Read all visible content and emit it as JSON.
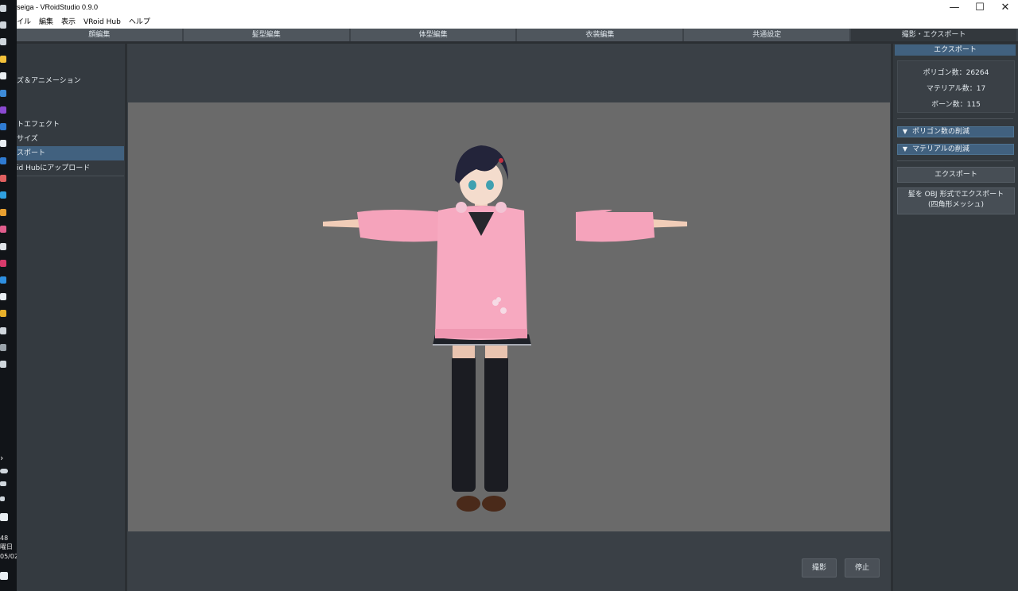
{
  "window": {
    "title": "seiga - VRoidStudio 0.9.0",
    "minimize_glyph": "—",
    "maximize_glyph": "☐",
    "close_glyph": "✕"
  },
  "menu": [
    "イル",
    "編集",
    "表示",
    "VRoid Hub",
    "ヘルプ"
  ],
  "tabs": [
    {
      "label": "顔編集"
    },
    {
      "label": "髪型編集"
    },
    {
      "label": "体型編集"
    },
    {
      "label": "衣装編集"
    },
    {
      "label": "共通設定"
    },
    {
      "label": "撮影・エクスポート",
      "active": true
    }
  ],
  "sidebar": {
    "items": [
      {
        "label": "ズ＆アニメーション"
      },
      {
        "label": "トエフェクト"
      },
      {
        "label": "サイズ"
      },
      {
        "label": "スポート",
        "selected": true
      },
      {
        "label": "id Hubにアップロード"
      }
    ]
  },
  "taskbar": {
    "time_text": "48",
    "day_text": "曜日",
    "date_text": "05/02",
    "chevron": "›"
  },
  "viewport": {
    "capture_label": "撮影",
    "stop_label": "停止"
  },
  "export_panel": {
    "header": "エクスポート",
    "polygon_count": "ポリゴン数：26264",
    "material_count": "マテリアル数：17",
    "bone_count": "ボーン数：115",
    "reduce_polygons": "ポリゴン数の削減",
    "reduce_materials": "マテリアルの削減",
    "export_button": "エクスポート",
    "export_hair_line1": "髪を OBJ 形式でエクスポート",
    "export_hair_line2": "(四角形メッシュ)"
  },
  "colors": {
    "accent": "#41617f",
    "viewport_bg": "#6a6a6a",
    "panel_bg": "#343a40",
    "sweater": "#f4a9bf"
  }
}
